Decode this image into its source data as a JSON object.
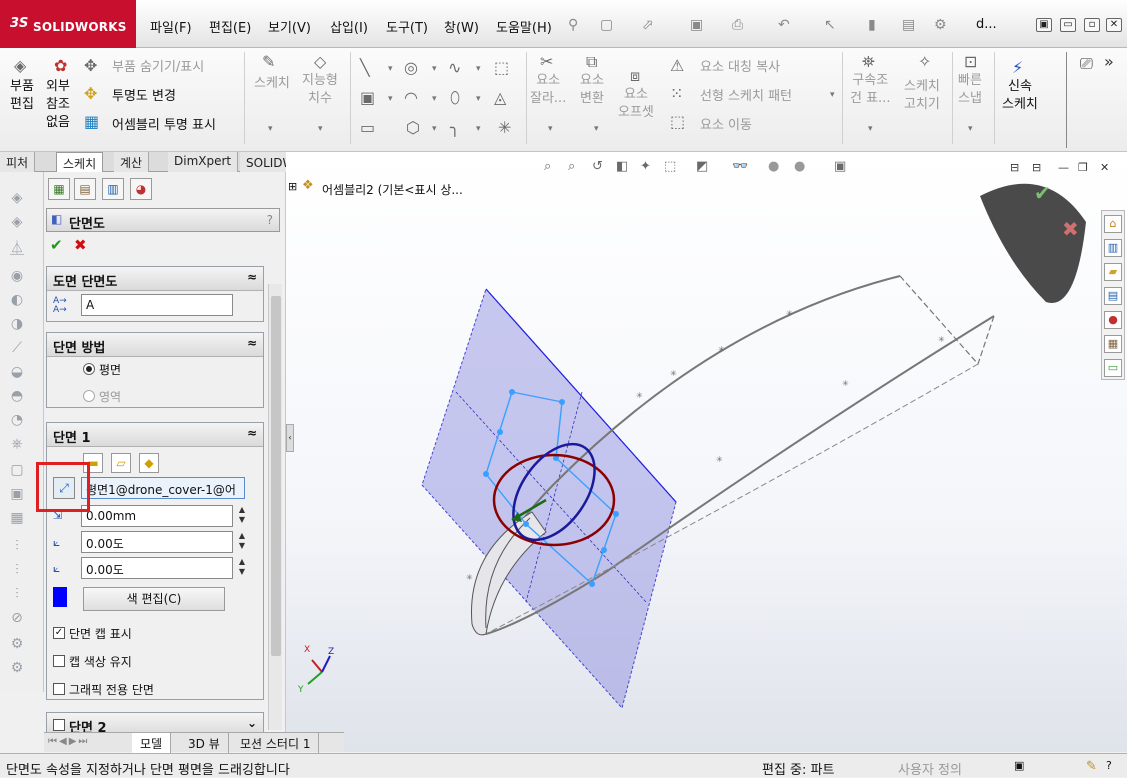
{
  "app": {
    "brand": "SOLIDWORKS",
    "ds_mark": "3S"
  },
  "menu": [
    "파일(F)",
    "편집(E)",
    "보기(V)",
    "삽입(I)",
    "도구(T)",
    "창(W)",
    "도움말(H)"
  ],
  "window": {
    "user_short": "d...",
    "controls": [
      "▣",
      "▭",
      "▫",
      "✕"
    ]
  },
  "ribbon": {
    "edit_part": "부품\n편집",
    "external_refs": "외부\n참조\n없음",
    "hide_show_parts": "부품 숨기기/표시",
    "change_transparency": "투명도 변경",
    "assembly_transparency": "어셈블리 투명 표시",
    "sketch": "스케치",
    "smart_dimension": "지능형\n치수",
    "trim_entities": "요소\n잘라...",
    "convert_entities": "요소\n변환",
    "offset_entities": "요소\n오프셋",
    "mirror_entities": "요소 대칭 복사",
    "linear_pattern": "선형 스케치 패턴",
    "move_entities": "요소 이동",
    "display_relations": "구속조\n건 표...",
    "repair_sketch": "스케치\n고치기",
    "quick_snaps": "빠른\n스냅",
    "rapid_sketch": "신속\n스케치"
  },
  "tabs": [
    "피처",
    "스케치",
    "계산",
    "DimXpert",
    "SOLIDWORKS 애드인"
  ],
  "active_tab": "스케치",
  "tree": {
    "root": "어셈블리2  (기본<표시 상..."
  },
  "property_manager": {
    "title": "단면도",
    "help": "?",
    "ok": "✔",
    "cancel": "✖",
    "group_drawing_section": "도면 단면도",
    "section_label": "A",
    "group_method": "단면 방법",
    "method_planar": "평면",
    "method_zonal": "영역",
    "group_section1": "단면 1",
    "reference_plane": "평면1@drone_cover-1@어",
    "offset_distance": "0.00mm",
    "rotation_x": "0.00도",
    "rotation_y": "0.00도",
    "edit_color": "색 편집(C)",
    "show_section_cap": "단면 캡 표시",
    "keep_cap_color": "캡 색상 유지",
    "graphics_only_section": "그래픽 전용 단면",
    "group_section2": "단면 2",
    "color": "#0000ff"
  },
  "bottom_tabs": [
    "모델",
    "3D 뷰",
    "모션 스터디 1"
  ],
  "status": {
    "message": "단면도 속성을 지정하거나 단면 평면을 드래깅합니다",
    "editing": "편집 중: 파트",
    "custom": "사용자 정의"
  },
  "colors": {
    "highlight": "#e02020",
    "plane": "#8888dd",
    "brand": "#c8102e"
  }
}
